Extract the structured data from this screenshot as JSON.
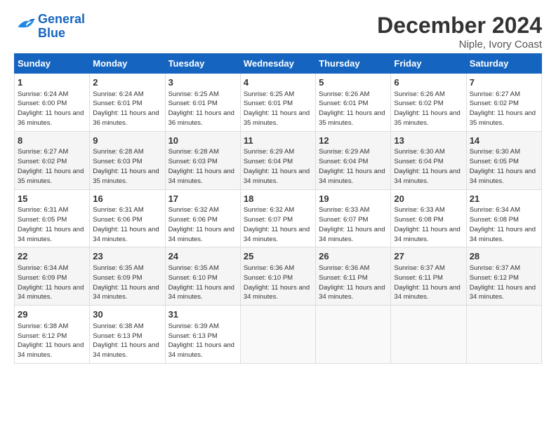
{
  "logo": {
    "line1": "General",
    "line2": "Blue"
  },
  "title": "December 2024",
  "location": "Niple, Ivory Coast",
  "days_of_week": [
    "Sunday",
    "Monday",
    "Tuesday",
    "Wednesday",
    "Thursday",
    "Friday",
    "Saturday"
  ],
  "weeks": [
    [
      {
        "day": "1",
        "sunrise": "6:24 AM",
        "sunset": "6:00 PM",
        "daylight": "11 hours and 36 minutes."
      },
      {
        "day": "2",
        "sunrise": "6:24 AM",
        "sunset": "6:01 PM",
        "daylight": "11 hours and 36 minutes."
      },
      {
        "day": "3",
        "sunrise": "6:25 AM",
        "sunset": "6:01 PM",
        "daylight": "11 hours and 36 minutes."
      },
      {
        "day": "4",
        "sunrise": "6:25 AM",
        "sunset": "6:01 PM",
        "daylight": "11 hours and 35 minutes."
      },
      {
        "day": "5",
        "sunrise": "6:26 AM",
        "sunset": "6:01 PM",
        "daylight": "11 hours and 35 minutes."
      },
      {
        "day": "6",
        "sunrise": "6:26 AM",
        "sunset": "6:02 PM",
        "daylight": "11 hours and 35 minutes."
      },
      {
        "day": "7",
        "sunrise": "6:27 AM",
        "sunset": "6:02 PM",
        "daylight": "11 hours and 35 minutes."
      }
    ],
    [
      {
        "day": "8",
        "sunrise": "6:27 AM",
        "sunset": "6:02 PM",
        "daylight": "11 hours and 35 minutes."
      },
      {
        "day": "9",
        "sunrise": "6:28 AM",
        "sunset": "6:03 PM",
        "daylight": "11 hours and 35 minutes."
      },
      {
        "day": "10",
        "sunrise": "6:28 AM",
        "sunset": "6:03 PM",
        "daylight": "11 hours and 34 minutes."
      },
      {
        "day": "11",
        "sunrise": "6:29 AM",
        "sunset": "6:04 PM",
        "daylight": "11 hours and 34 minutes."
      },
      {
        "day": "12",
        "sunrise": "6:29 AM",
        "sunset": "6:04 PM",
        "daylight": "11 hours and 34 minutes."
      },
      {
        "day": "13",
        "sunrise": "6:30 AM",
        "sunset": "6:04 PM",
        "daylight": "11 hours and 34 minutes."
      },
      {
        "day": "14",
        "sunrise": "6:30 AM",
        "sunset": "6:05 PM",
        "daylight": "11 hours and 34 minutes."
      }
    ],
    [
      {
        "day": "15",
        "sunrise": "6:31 AM",
        "sunset": "6:05 PM",
        "daylight": "11 hours and 34 minutes."
      },
      {
        "day": "16",
        "sunrise": "6:31 AM",
        "sunset": "6:06 PM",
        "daylight": "11 hours and 34 minutes."
      },
      {
        "day": "17",
        "sunrise": "6:32 AM",
        "sunset": "6:06 PM",
        "daylight": "11 hours and 34 minutes."
      },
      {
        "day": "18",
        "sunrise": "6:32 AM",
        "sunset": "6:07 PM",
        "daylight": "11 hours and 34 minutes."
      },
      {
        "day": "19",
        "sunrise": "6:33 AM",
        "sunset": "6:07 PM",
        "daylight": "11 hours and 34 minutes."
      },
      {
        "day": "20",
        "sunrise": "6:33 AM",
        "sunset": "6:08 PM",
        "daylight": "11 hours and 34 minutes."
      },
      {
        "day": "21",
        "sunrise": "6:34 AM",
        "sunset": "6:08 PM",
        "daylight": "11 hours and 34 minutes."
      }
    ],
    [
      {
        "day": "22",
        "sunrise": "6:34 AM",
        "sunset": "6:09 PM",
        "daylight": "11 hours and 34 minutes."
      },
      {
        "day": "23",
        "sunrise": "6:35 AM",
        "sunset": "6:09 PM",
        "daylight": "11 hours and 34 minutes."
      },
      {
        "day": "24",
        "sunrise": "6:35 AM",
        "sunset": "6:10 PM",
        "daylight": "11 hours and 34 minutes."
      },
      {
        "day": "25",
        "sunrise": "6:36 AM",
        "sunset": "6:10 PM",
        "daylight": "11 hours and 34 minutes."
      },
      {
        "day": "26",
        "sunrise": "6:36 AM",
        "sunset": "6:11 PM",
        "daylight": "11 hours and 34 minutes."
      },
      {
        "day": "27",
        "sunrise": "6:37 AM",
        "sunset": "6:11 PM",
        "daylight": "11 hours and 34 minutes."
      },
      {
        "day": "28",
        "sunrise": "6:37 AM",
        "sunset": "6:12 PM",
        "daylight": "11 hours and 34 minutes."
      }
    ],
    [
      {
        "day": "29",
        "sunrise": "6:38 AM",
        "sunset": "6:12 PM",
        "daylight": "11 hours and 34 minutes."
      },
      {
        "day": "30",
        "sunrise": "6:38 AM",
        "sunset": "6:13 PM",
        "daylight": "11 hours and 34 minutes."
      },
      {
        "day": "31",
        "sunrise": "6:39 AM",
        "sunset": "6:13 PM",
        "daylight": "11 hours and 34 minutes."
      },
      null,
      null,
      null,
      null
    ]
  ]
}
